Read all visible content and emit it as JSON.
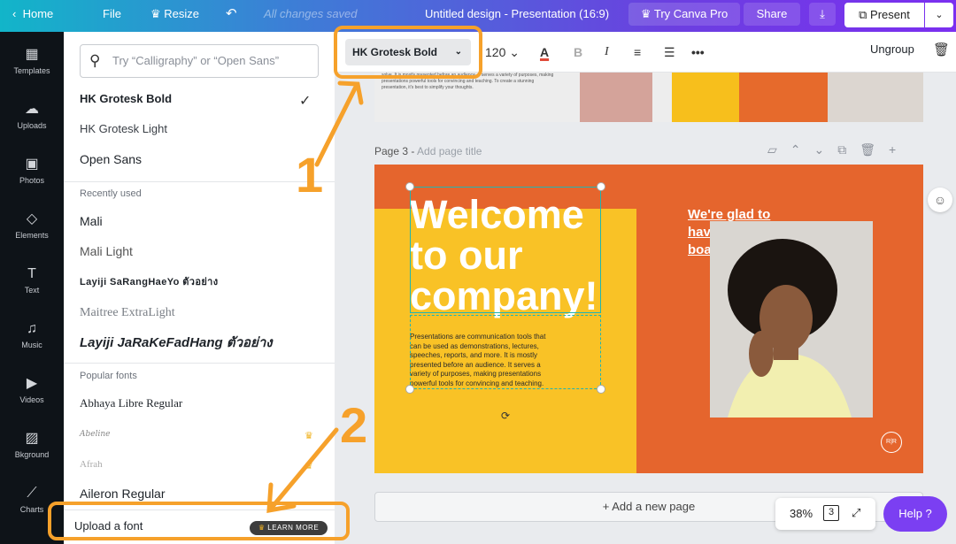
{
  "topbar": {
    "home": "Home",
    "file": "File",
    "resize": "Resize",
    "undo_icon": "undo-icon",
    "saved": "All changes saved",
    "title": "Untitled design - Presentation (16:9)",
    "try_pro": "Try Canva Pro",
    "share": "Share",
    "present": "Present"
  },
  "leftnav": [
    {
      "label": "Templates",
      "icon": "▦"
    },
    {
      "label": "Uploads",
      "icon": "☁"
    },
    {
      "label": "Photos",
      "icon": "▣"
    },
    {
      "label": "Elements",
      "icon": "◇"
    },
    {
      "label": "Text",
      "icon": "T"
    },
    {
      "label": "Music",
      "icon": "♫"
    },
    {
      "label": "Videos",
      "icon": "▶"
    },
    {
      "label": "Bkground",
      "icon": "▨"
    },
    {
      "label": "Charts",
      "icon": "⟋"
    }
  ],
  "fontpanel": {
    "search_placeholder": "Try “Calligraphy” or “Open Sans”",
    "top_fonts": [
      "HK Grotesk Bold",
      "HK Grotesk Light",
      "Open Sans"
    ],
    "recently_used_label": "Recently used",
    "recent": [
      "Mali",
      "Mali Light",
      "Layiji SaRangHaeYo ตัวอย่าง",
      "Maitree ExtraLight",
      "Layiji JaRaKeFadHang ตัวอย่าง"
    ],
    "popular_label": "Popular fonts",
    "popular": [
      "Abhaya Libre Regular",
      "Abeline",
      "Afrah",
      "Aileron Regular"
    ],
    "upload": "Upload a font",
    "learn_more": "LEARN MORE"
  },
  "toolbar": {
    "font": "HK Grotesk Bold",
    "size": "120",
    "ungroup": "Ungroup"
  },
  "canvas": {
    "page2_text": "solve. It is mostly presented before an audience. It serves a variety of purposes, making presentations powerful tools for convincing and teaching. To create a stunning presentation, it's best to simplify your thoughts.",
    "page3_label": "Page 3 - ",
    "page3_add": "Add page title",
    "headline": "Welcome to our company!",
    "body": "Presentations are communication tools that can be used as demonstrations, lectures, speeches, reports, and more. It is mostly presented before an audience. It serves a variety of purposes, making presentations powerful tools for convincing and teaching.",
    "glad": "We're glad to have you on board!",
    "logo": "R|R",
    "add_page": "+ Add a new page",
    "zoom": "38%",
    "page_count": "3",
    "help": "Help ?"
  },
  "annotations": {
    "one": "1",
    "two": "2"
  },
  "colors": {
    "accent": "#f6a12b",
    "slide_orange": "#e5652d",
    "slide_yellow": "#f9c226",
    "selection": "#1fb5b3",
    "help_purple": "#7b3ff2"
  }
}
